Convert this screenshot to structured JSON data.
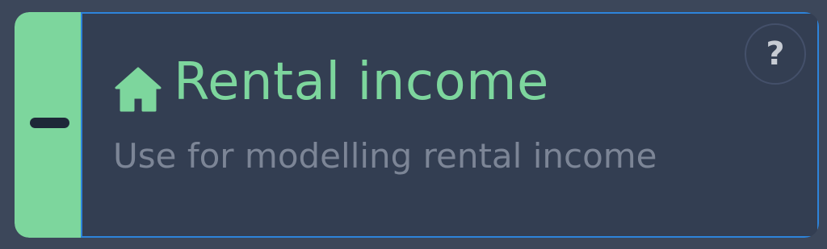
{
  "card": {
    "title": "Rental income",
    "description": "Use for modelling rental income",
    "icon": "house-icon",
    "collapse_icon": "minus-icon",
    "help_label": "?",
    "accent_color": "#7dd69d",
    "selection_border_color": "#2d84db"
  }
}
